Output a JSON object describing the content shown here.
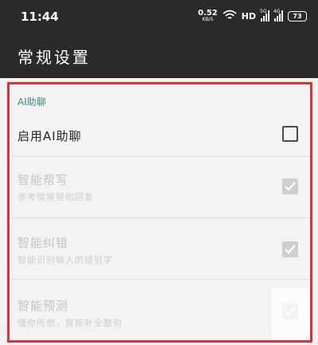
{
  "status_bar": {
    "time": "11:44",
    "net_speed_value": "0.52",
    "net_speed_unit": "KB/S",
    "hd_label": "HD",
    "signal1_tag": "5G",
    "signal2_tag": "4G",
    "battery": "73"
  },
  "app_bar": {
    "title": "常规设置"
  },
  "section": {
    "header": "AI助聊"
  },
  "settings": [
    {
      "title": "启用AI助聊",
      "subtitle": "",
      "checked": false,
      "enabled": true
    },
    {
      "title": "智能帮写",
      "subtitle": "参考情境帮你回复",
      "checked": true,
      "enabled": false
    },
    {
      "title": "智能纠错",
      "subtitle": "智能识别输入的错别字",
      "checked": true,
      "enabled": false
    },
    {
      "title": "智能预测",
      "subtitle": "懂你所想，智能补全整句",
      "checked": true,
      "enabled": false
    }
  ],
  "colors": {
    "app_bar_bg": "#2a2a2a",
    "highlight_border": "#d9343a",
    "section_header": "#3a8a8a"
  },
  "icons": [
    "wifi-icon",
    "signal-icon",
    "battery-icon",
    "checkbox-icon",
    "checkmark-icon"
  ]
}
